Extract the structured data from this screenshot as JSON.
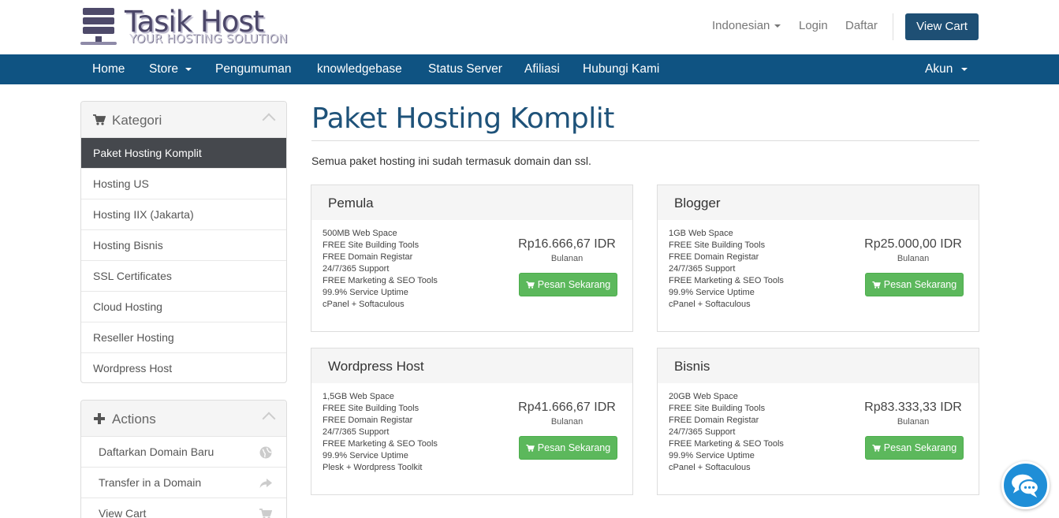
{
  "brand": {
    "name": "Tasik Host",
    "tagline": "YOUR HOSTING SOLUTION"
  },
  "top_links": {
    "language": "Indonesian",
    "login": "Login",
    "register": "Daftar",
    "view_cart": "View Cart"
  },
  "nav": {
    "items": [
      "Home",
      "Store",
      "Pengumuman",
      "knowledgebase",
      "Status Server",
      "Afiliasi",
      "Hubungi Kami"
    ],
    "account": "Akun"
  },
  "sidebar": {
    "categories": {
      "title": "Kategori",
      "items": [
        "Paket Hosting Komplit",
        "Hosting US",
        "Hosting IIX (Jakarta)",
        "Hosting Bisnis",
        "SSL Certificates",
        "Cloud Hosting",
        "Reseller Hosting",
        "Wordpress Host"
      ]
    },
    "actions": {
      "title": "Actions",
      "items": [
        "Daftarkan Domain Baru",
        "Transfer in a Domain",
        "View Cart"
      ]
    }
  },
  "main": {
    "title": "Paket Hosting Komplit",
    "intro": "Semua paket hosting ini sudah termasuk domain dan ssl."
  },
  "products": [
    {
      "name": "Pemula",
      "features": [
        "500MB Web Space",
        "FREE Site Building Tools",
        "FREE Domain Registar",
        "24/7/365 Support",
        "FREE Marketing & SEO Tools",
        "99.9% Service Uptime",
        "cPanel + Softaculous"
      ],
      "price": "Rp16.666,67 IDR",
      "cycle": "Bulanan",
      "button": "Pesan Sekarang"
    },
    {
      "name": "Blogger",
      "features": [
        "1GB Web Space",
        "FREE Site Building Tools",
        "FREE Domain Registar",
        "24/7/365 Support",
        "FREE Marketing & SEO Tools",
        "99.9% Service Uptime",
        "cPanel + Softaculous"
      ],
      "price": "Rp25.000,00 IDR",
      "cycle": "Bulanan",
      "button": "Pesan Sekarang"
    },
    {
      "name": "Wordpress Host",
      "features": [
        "1,5GB Web Space",
        "FREE Site Building Tools",
        "FREE Domain Registar",
        "24/7/365 Support",
        "FREE Marketing & SEO Tools",
        "99.9% Service Uptime",
        "Plesk + Wordpress Toolkit"
      ],
      "price": "Rp41.666,67 IDR",
      "cycle": "Bulanan",
      "button": "Pesan Sekarang"
    },
    {
      "name": "Bisnis",
      "features": [
        "20GB Web Space",
        "FREE Site Building Tools",
        "FREE Domain Registar",
        "24/7/365 Support",
        "FREE Marketing & SEO Tools",
        "99.9% Service Uptime",
        "cPanel + Softaculous"
      ],
      "price": "Rp83.333,33 IDR",
      "cycle": "Bulanan",
      "button": "Pesan Sekarang"
    }
  ],
  "icons": {
    "cart": "cart-icon",
    "plus": "plus-icon",
    "globe": "globe-icon",
    "share": "share-icon",
    "chat": "chat-icon"
  },
  "colors": {
    "navbar": "#0f5382",
    "cart_button": "#1e4f74",
    "order_button": "#5cb85c",
    "active_category": "#45484d",
    "title": "#1e5279",
    "chat": "#1f8ed7"
  }
}
